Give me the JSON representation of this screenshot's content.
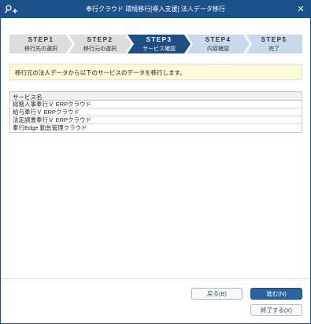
{
  "window": {
    "title": "奉行クラウド 環境移行[導入支援] 法人データ移行",
    "icon": "key-plus-icon",
    "close_icon": "close-icon",
    "close_glyph": "✕"
  },
  "steps": [
    {
      "number": "STEP1",
      "label": "移行先の選択",
      "state": "done"
    },
    {
      "number": "STEP2",
      "label": "移行元の選択",
      "state": "done"
    },
    {
      "number": "STEP3",
      "label": "サービス確認",
      "state": "active"
    },
    {
      "number": "STEP4",
      "label": "内容確認",
      "state": "pending"
    },
    {
      "number": "STEP5",
      "label": "完了",
      "state": "pending"
    }
  ],
  "notice": "移行元の法人データから以下のサービスのデータを移行します。",
  "services": {
    "header": "サービス名",
    "rows": [
      "総務人事奉行Ｖ ERPクラウド",
      "給与奉行Ｖ ERPクラウド",
      "法定調書奉行Ｖ ERPクラウド",
      "奉行Edge 勤怠管理クラウド"
    ]
  },
  "buttons": {
    "back": "戻る(B)",
    "next": "進む(N)",
    "exit": "終了する(X)"
  },
  "colors": {
    "titlebar": "#1d5189",
    "step_done": "#dcdcdc",
    "step_active": "#1d4f86",
    "step_pending": "#c9d9ec",
    "notice_bg": "#fdf8d8",
    "primary_button": "#2a62a5"
  }
}
